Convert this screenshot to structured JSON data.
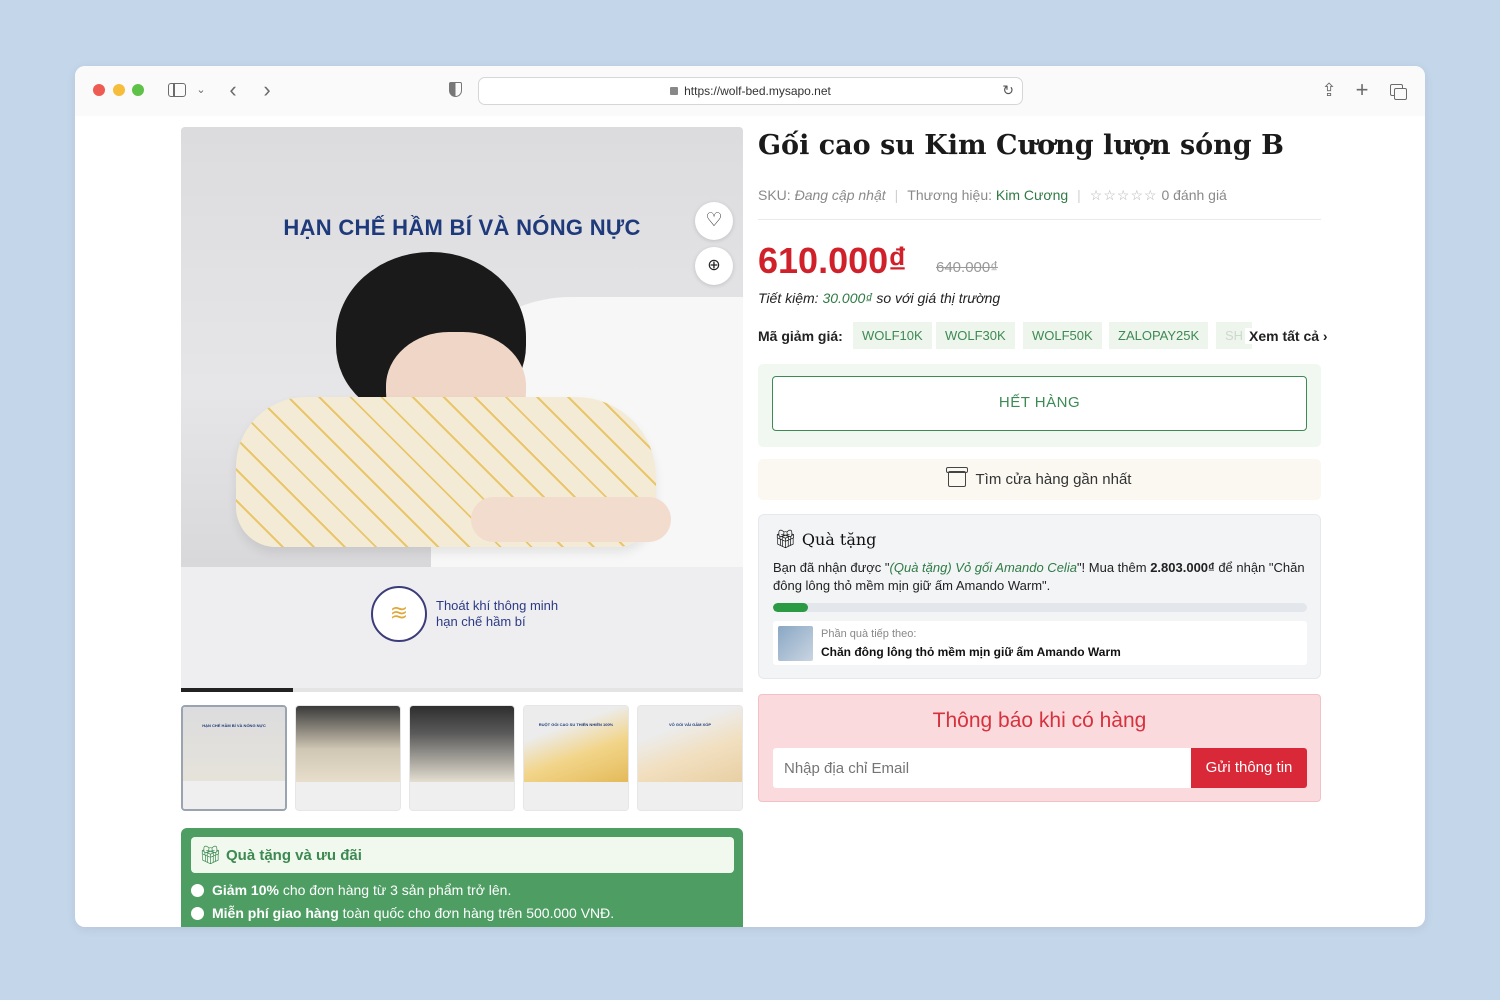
{
  "browser": {
    "url": "https://wolf-bed.mysapo.net"
  },
  "gallery": {
    "headline": "HẠN CHẾ HẦM BÍ VÀ NÓNG NỰC",
    "feature_line1": "Thoát khí thông minh",
    "feature_line2": "hạn chế hầm bí",
    "thumb1_caption": "HẠN CHẾ HẦM BÍ VÀ NÓNG NỰC",
    "thumb4_caption": "RUỘT GỐI CAO SU THIÊN NHIÊN 100%",
    "thumb5_caption": "VỎ GỐI VẢI GẤM XỐP",
    "slide_progress": 0.2
  },
  "promo": {
    "title": "Quà tặng và ưu đãi",
    "item1_bold": "Giảm 10%",
    "item1_rest": " cho đơn hàng từ 3 sản phẩm trở lên.",
    "item2_bold": "Miễn phí giao hàng",
    "item2_rest": " toàn quốc cho đơn hàng trên 500.000 VNĐ."
  },
  "product": {
    "title": "Gối cao su Kim Cương lượn sóng B",
    "sku_label": "SKU:",
    "sku_value": "Đang cập nhật",
    "brand_label": "Thương hiệu:",
    "brand_value": "Kim Cương",
    "stars": "☆☆☆☆☆",
    "reviews": "0 đánh giá",
    "rating": 0,
    "price": "610.000₫",
    "old_price": "640.000₫",
    "saving_label": "Tiết kiệm:",
    "saving_amount": "30.000₫",
    "saving_rest": "so với giá thị trường"
  },
  "coupons": {
    "label": "Mã giảm giá:",
    "codes": [
      "WOLF10K",
      "WOLF30K",
      "WOLF50K",
      "ZALOPAY25K",
      "SH"
    ],
    "see_all": "Xem tất cả"
  },
  "actions": {
    "out_of_stock": "HẾT HÀNG",
    "find_store": "Tìm cửa hàng gần nhất"
  },
  "gift": {
    "title": "Quà tặng",
    "desc_1": "Bạn đã nhận được \"",
    "desc_gift": "(Quà tặng) Vỏ gối Amando Celia",
    "desc_2": "\"! Mua thêm ",
    "desc_amount": "2.803.000₫",
    "desc_3": " để nhận \"Chăn đông lông thỏ mềm mịn giữ ấm Amando Warm\".",
    "progress": 0.066,
    "next_label": "Phần quà tiếp theo:",
    "next_name": "Chăn đông lông thỏ mềm mịn giữ ấm Amando Warm"
  },
  "notify": {
    "title": "Thông báo khi có hàng",
    "email_placeholder": "Nhập địa chỉ Email",
    "send_label": "Gửi thông tin"
  },
  "colors": {
    "price_red": "#d0202a",
    "brand_green": "#2f7a45",
    "promo_green": "#4e9e64"
  }
}
